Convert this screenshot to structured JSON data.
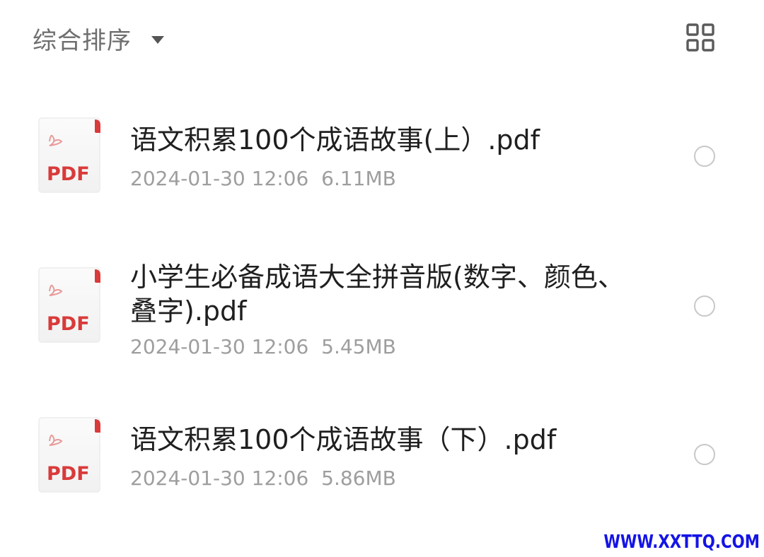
{
  "sortbar": {
    "label": "综合排序",
    "caret_icon": "caret-down-icon"
  },
  "header": {
    "view_toggle_icon": "grid-view-icon"
  },
  "files": [
    {
      "name": "语文积累100个成语故事(上）.pdf",
      "date": "2024-01-30 12:06",
      "size": "6.11MB",
      "icon": "pdf-file-icon",
      "icon_label": "PDF",
      "selected": false
    },
    {
      "name": "小学生必备成语大全拼音版(数字、颜色、叠字).pdf",
      "date": "2024-01-30 12:06",
      "size": "5.45MB",
      "icon": "pdf-file-icon",
      "icon_label": "PDF",
      "selected": false
    },
    {
      "name": "语文积累100个成语故事（下）.pdf",
      "date": "2024-01-30 12:06",
      "size": "5.86MB",
      "icon": "pdf-file-icon",
      "icon_label": "PDF",
      "selected": false
    }
  ],
  "watermark": "WWW.XXTTQ.COM",
  "colors": {
    "pdf_red": "#d93a3a",
    "watermark_blue": "#1414e6",
    "meta_gray": "#9e9e9e"
  }
}
